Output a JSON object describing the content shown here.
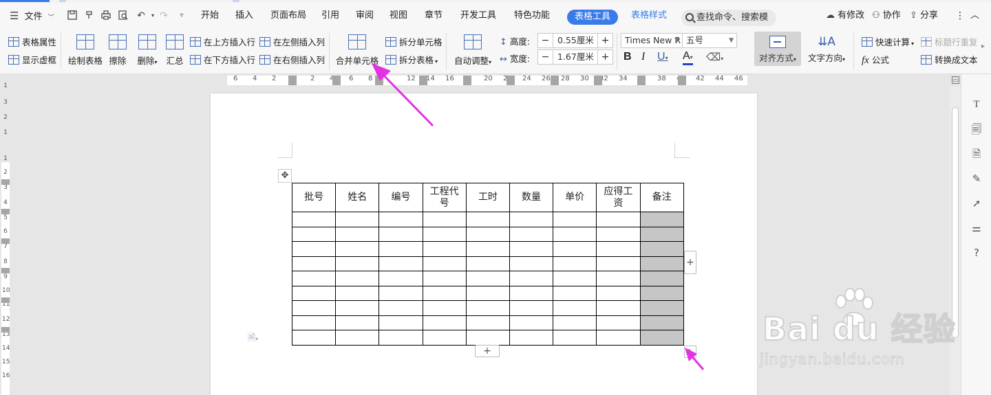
{
  "menubar": {
    "file": "文件",
    "tabs": [
      "开始",
      "插入",
      "页面布局",
      "引用",
      "审阅",
      "视图",
      "章节",
      "开发工具",
      "特色功能"
    ],
    "active_tab": "表格工具",
    "style_tab": "表格样式",
    "search": "查找命令、搜索模板",
    "has_changes": "有修改",
    "collab": "协作",
    "share": "分享"
  },
  "ribbon": {
    "table_props": "表格属性",
    "show_grid": "显示虚框",
    "draw_table": "绘制表格",
    "erase": "擦除",
    "delete": "删除",
    "summary": "汇总",
    "insert_above": "在上方插入行",
    "insert_below": "在下方插入行",
    "insert_left": "在左侧插入列",
    "insert_right": "在右侧插入列",
    "merge_cells": "合并单元格",
    "split_cells": "拆分单元格",
    "split_table": "拆分表格",
    "auto_fit": "自动调整",
    "height_label": "高度:",
    "height_value": "0.55厘米",
    "width_label": "宽度:",
    "width_value": "1.67厘米",
    "font": "Times New R",
    "font_size": "五号",
    "align": "对齐方式",
    "text_dir": "文字方向",
    "quick_calc": "快速计算",
    "repeat_header": "标题行重复",
    "formula": "公式",
    "to_text": "转换成文本"
  },
  "ruler": {
    "h": [
      "6",
      "4",
      "2",
      "2",
      "4",
      "6",
      "8",
      "12",
      "14",
      "16",
      "20",
      "22",
      "24",
      "26",
      "28",
      "30",
      "32",
      "34",
      "38",
      "40",
      "42",
      "44",
      "46"
    ],
    "v": [
      "1",
      "3",
      "2",
      "1",
      "1",
      "2",
      "3",
      "4",
      "5",
      "6",
      "7",
      "8",
      "9",
      "10",
      "11",
      "12",
      "13",
      "14",
      "15",
      "16"
    ]
  },
  "table": {
    "headers": [
      "批号",
      "姓名",
      "编号",
      "工程代号",
      "工时",
      "数量",
      "单价",
      "应得工资",
      "备注"
    ],
    "rows": 9
  },
  "watermark": {
    "brand": "Bai du 经验",
    "url": "jingyan.baidu.com"
  },
  "colors": {
    "accent": "#3b7be8",
    "arrow": "#e232e2",
    "shade": "#c6c6c6"
  }
}
